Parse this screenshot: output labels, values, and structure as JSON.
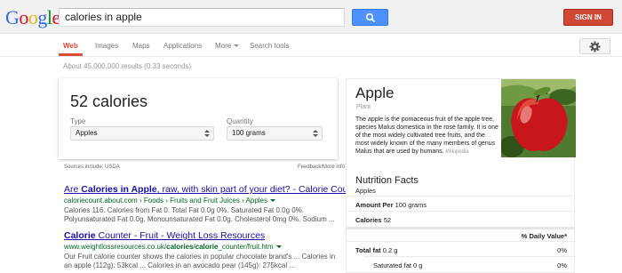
{
  "header": {
    "logo_letters": [
      {
        "ch": "G",
        "color": "#3369e8"
      },
      {
        "ch": "o",
        "color": "#d50f25"
      },
      {
        "ch": "o",
        "color": "#eeb211"
      },
      {
        "ch": "g",
        "color": "#3369e8"
      },
      {
        "ch": "l",
        "color": "#009925"
      },
      {
        "ch": "e",
        "color": "#d50f25"
      }
    ],
    "search_value": "calories in apple",
    "search_icon": "search-icon",
    "signin_label": "SIGN IN"
  },
  "nav": {
    "items": [
      "Web",
      "Images",
      "Maps",
      "Applications",
      "More",
      "Search tools"
    ],
    "active": "Web",
    "accent": "#dd4b39",
    "settings_icon": "gear-icon"
  },
  "result_stats": "About 45,000,000 results (0.33 seconds)",
  "calculator": {
    "value": "52 calories",
    "type_label": "Type",
    "type_value": "Apples",
    "quantity_label": "Quantity",
    "quantity_value": "100 grams",
    "sources": "Sources include: USDA",
    "feedback": "Feedback/More info"
  },
  "results": [
    {
      "title_pre": "Are ",
      "title_bold": "Calories in Apple",
      "title_post": ", raw, with skin part of your diet? - Calorie Count",
      "url": "caloriecount.about.com › Foods › Fruits and Fruit Juices › Apples",
      "snippet1": "Calories 116. Calories from Fat 0. Total Fat 0.0g 0%. Saturated Fat 0.0g 0%.",
      "snippet2": "Polyunsaturated Fat 0.0g. Monounsaturated Fat 0.0g. Cholesterol 0mg 0%. Sodium ..."
    },
    {
      "title_pre": "",
      "title_bold": "Calorie",
      "title_post": " Counter - Fruit - Weight Loss Resources",
      "url_pre": "www.weightlossresources.co.uk/",
      "url_bold": "calories",
      "url_mid": "/",
      "url_bold2": "calorie",
      "url_post": "_counter/fruit.htm",
      "snippet1": "Our Fruit calorie counter shows the calories in popular chocolate brand's ... Calories in",
      "snippet2": "an apple (112g): 53kcal ... Calories in an avocado pear (145g): 275kcal ..."
    }
  ],
  "knowledge_panel": {
    "title": "Apple",
    "subtitle": "Plant",
    "description": "The apple is the pomaceous fruit of the apple tree, species Malus domestica in the rose family. It is one of the most widely cultivated tree fruits, and the most widely known of the many members of genus Malus that are used by humans.",
    "wiki": "Wikipedia",
    "nutrition_header": "Nutrition Facts",
    "nutrition_sub": "Apples",
    "amount_per_label": "Amount Per",
    "amount_per_value": "100 grams",
    "calories_label": "Calories",
    "calories_value": "52",
    "daily_value_header": "% Daily Value*",
    "total_fat_label": "Total fat",
    "total_fat_value": "0.2 g",
    "total_fat_pct": "0%",
    "sat_fat_label": "Saturated fat",
    "sat_fat_value": "0 g",
    "sat_fat_pct": "0%"
  }
}
